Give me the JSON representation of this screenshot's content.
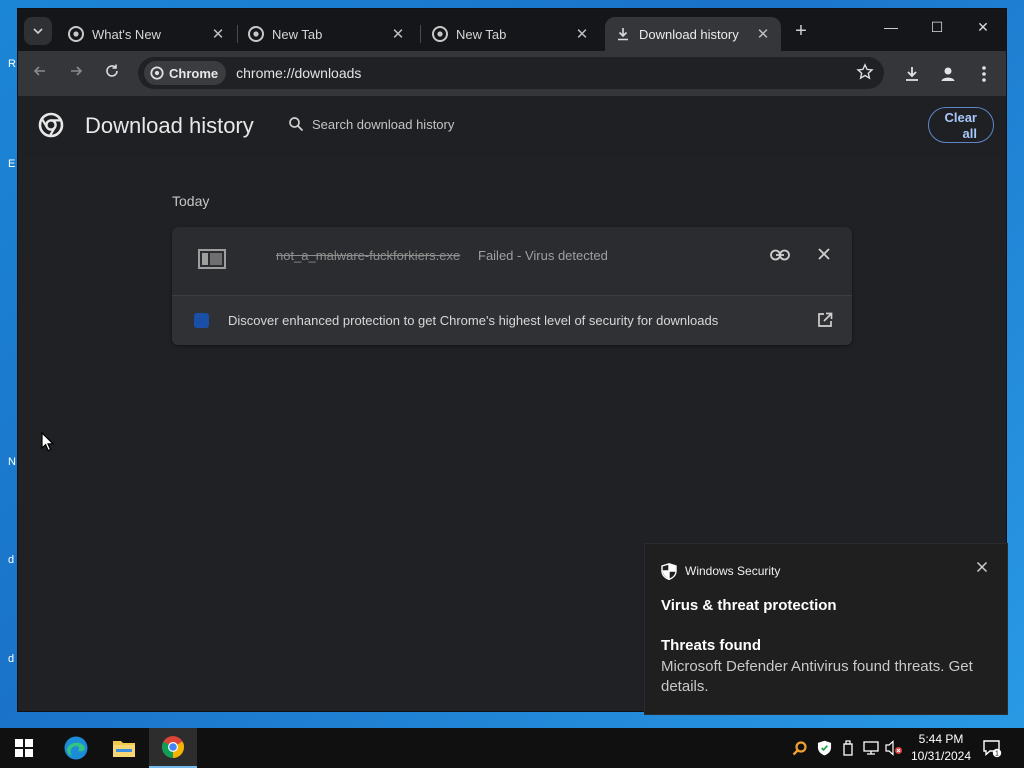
{
  "browser": {
    "tabs": [
      {
        "title": "What's New",
        "close": "✕"
      },
      {
        "title": "New Tab",
        "close": "✕"
      },
      {
        "title": "New Tab",
        "close": "✕"
      },
      {
        "title": "Download history",
        "close": "✕"
      }
    ],
    "new_tab": "+",
    "window_controls": {
      "minimize": "—",
      "maximize": "☐",
      "close": "✕"
    },
    "site_chip": "Chrome",
    "url": "chrome://downloads"
  },
  "downloads": {
    "title": "Download history",
    "search_placeholder": "Search download history",
    "clear_all_line1": "Clear",
    "clear_all_line2": "all",
    "date_heading": "Today",
    "items": [
      {
        "file_name": "not_a_malware-fuckforkiers.exe",
        "status": "Failed - Virus detected"
      }
    ],
    "promo": "Discover enhanced protection to get Chrome's highest level of security for downloads"
  },
  "toast": {
    "app": "Windows Security",
    "heading": "Virus & threat protection",
    "subheading": "Threats found",
    "body": "Microsoft Defender Antivirus found threats. Get details."
  },
  "taskbar": {
    "time": "5:44 PM",
    "date": "10/31/2024",
    "notification_count": "1"
  },
  "colors": {
    "accent_blue": "#a8c7fa",
    "toolbar": "#35363a",
    "page_bg": "#202124",
    "desktop": "#1a73c9"
  }
}
